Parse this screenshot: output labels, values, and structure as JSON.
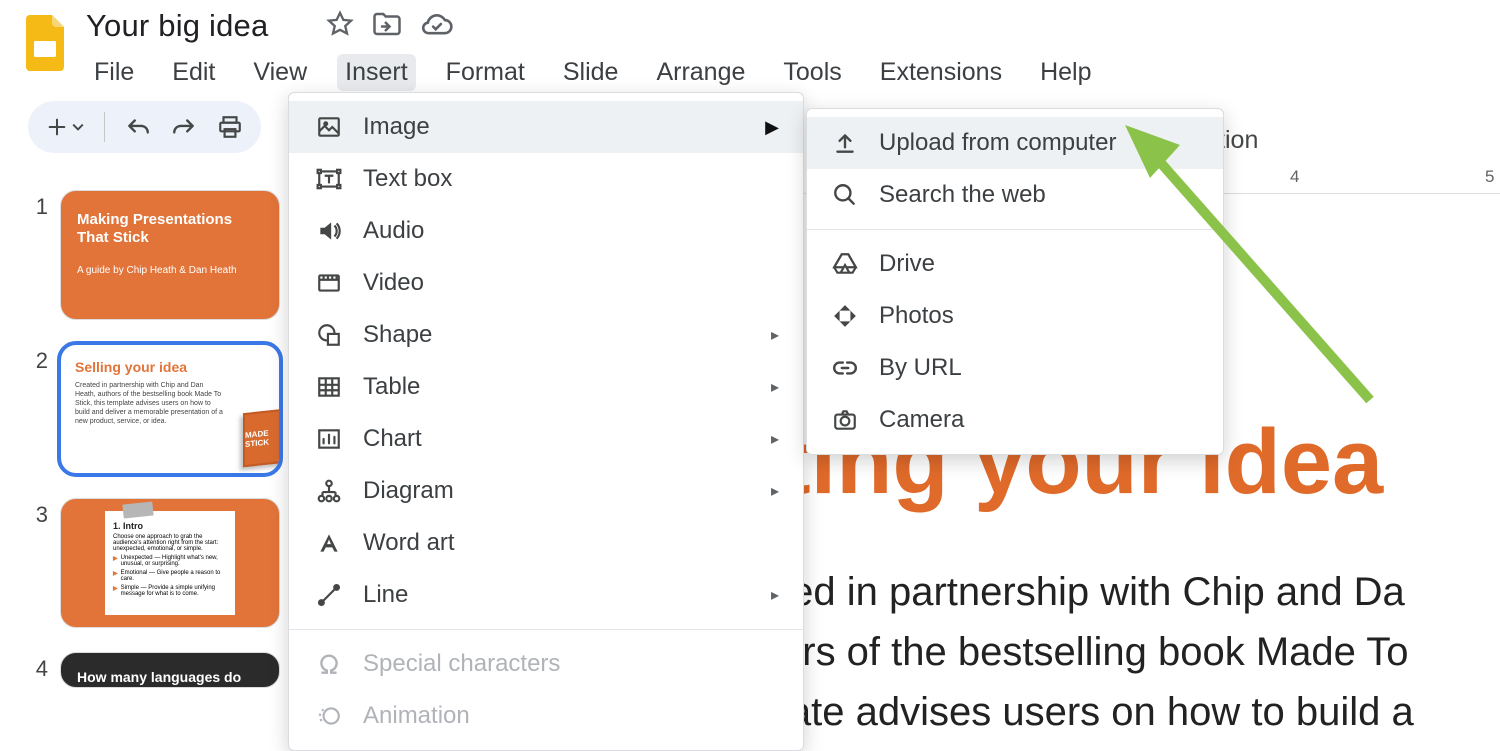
{
  "header": {
    "doc_title": "Your big idea",
    "starred": false
  },
  "menubar": {
    "items": [
      "File",
      "Edit",
      "View",
      "Insert",
      "Format",
      "Slide",
      "Arrange",
      "Tools",
      "Extensions",
      "Help"
    ],
    "active": "Insert"
  },
  "toolbar": {
    "transition_label": "sition"
  },
  "insert_menu": {
    "items": [
      {
        "label": "Image",
        "icon": "image-icon",
        "arrow": true,
        "hov": true
      },
      {
        "label": "Text box",
        "icon": "textbox-icon"
      },
      {
        "label": "Audio",
        "icon": "audio-icon"
      },
      {
        "label": "Video",
        "icon": "video-icon"
      },
      {
        "label": "Shape",
        "icon": "shape-icon",
        "arrow": true
      },
      {
        "label": "Table",
        "icon": "table-icon",
        "arrow": true
      },
      {
        "label": "Chart",
        "icon": "chart-icon",
        "arrow": true
      },
      {
        "label": "Diagram",
        "icon": "diagram-icon",
        "arrow": true
      },
      {
        "label": "Word art",
        "icon": "wordart-icon"
      },
      {
        "label": "Line",
        "icon": "line-icon",
        "arrow": true
      }
    ],
    "disabled_items": [
      {
        "label": "Special characters",
        "icon": "omega-icon"
      },
      {
        "label": "Animation",
        "icon": "animation-icon"
      }
    ]
  },
  "image_submenu": {
    "items_a": [
      {
        "label": "Upload from computer",
        "icon": "upload-icon",
        "hov": true
      },
      {
        "label": "Search the web",
        "icon": "search-icon"
      }
    ],
    "items_b": [
      {
        "label": "Drive",
        "icon": "drive-icon"
      },
      {
        "label": "Photos",
        "icon": "photos-icon"
      },
      {
        "label": "By URL",
        "icon": "link-icon"
      },
      {
        "label": "Camera",
        "icon": "camera-icon"
      }
    ]
  },
  "ruler": {
    "marks": [
      "4",
      "5"
    ]
  },
  "thumbnails": {
    "items": [
      {
        "num": "1",
        "kind": "t1",
        "title": "Making Presentations That Stick",
        "sub": "A guide by Chip Heath & Dan Heath"
      },
      {
        "num": "2",
        "kind": "t2",
        "selected": true,
        "title": "Selling your idea",
        "body": "Created in partnership with Chip and Dan Heath, authors of the bestselling book Made To Stick, this template advises users on how to build and deliver a memorable presentation of a new product, service, or idea.",
        "book": "MADE STICK"
      },
      {
        "num": "3",
        "kind": "t3",
        "title": "1. Intro",
        "rows": [
          "Choose one approach to grab the audience's attention right from the start: unexpected, emotional, or simple.",
          "Unexpected — Highlight what's new, unusual, or surprising.",
          "Emotional — Give people a reason to care.",
          "Simple — Provide a simple unifying message for what is to come."
        ]
      },
      {
        "num": "4",
        "kind": "t4",
        "title": "How many languages do"
      }
    ]
  },
  "slide": {
    "heading_fragment": "ting your idea",
    "line1": "ted in partnership with Chip and Da",
    "line2": "ors of the bestselling book Made To",
    "line3": "late advises users on how to build a"
  }
}
